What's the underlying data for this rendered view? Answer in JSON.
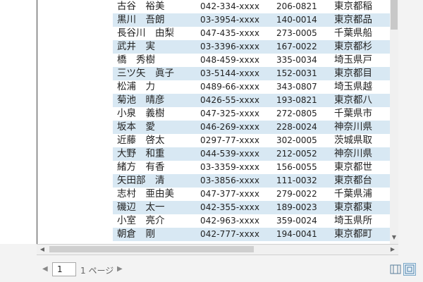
{
  "table": {
    "rows": [
      {
        "name": "古谷　裕美",
        "phone": "042-334-xxxx",
        "zip": "206-0821",
        "addr": "東京都稲"
      },
      {
        "name": "黒川　吾朗",
        "phone": "03-3954-xxxx",
        "zip": "140-0014",
        "addr": "東京都品"
      },
      {
        "name": "長谷川　由梨",
        "phone": "047-435-xxxx",
        "zip": "273-0005",
        "addr": "千葉県船"
      },
      {
        "name": "武井　実",
        "phone": "03-3396-xxxx",
        "zip": "167-0022",
        "addr": "東京都杉"
      },
      {
        "name": "橋　秀樹",
        "phone": "048-459-xxxx",
        "zip": "335-0034",
        "addr": "埼玉県戸"
      },
      {
        "name": "三ツ矢　眞子",
        "phone": "03-5144-xxxx",
        "zip": "152-0031",
        "addr": "東京都目"
      },
      {
        "name": "松浦　力",
        "phone": "0489-66-xxxx",
        "zip": "343-0807",
        "addr": "埼玉県越"
      },
      {
        "name": "菊池　晴彦",
        "phone": "0426-55-xxxx",
        "zip": "193-0821",
        "addr": "東京都八"
      },
      {
        "name": "小泉　義樹",
        "phone": "047-325-xxxx",
        "zip": "272-0805",
        "addr": "千葉県市"
      },
      {
        "name": "坂本　愛",
        "phone": "046-269-xxxx",
        "zip": "228-0024",
        "addr": "神奈川県"
      },
      {
        "name": "近藤　啓太",
        "phone": "0297-77-xxxx",
        "zip": "302-0005",
        "addr": "茨城県取"
      },
      {
        "name": "大野　和重",
        "phone": "044-539-xxxx",
        "zip": "212-0052",
        "addr": "神奈川県"
      },
      {
        "name": "緒方　有香",
        "phone": "03-3359-xxxx",
        "zip": "156-0055",
        "addr": "東京都世"
      },
      {
        "name": "矢田部　清",
        "phone": "03-3856-xxxx",
        "zip": "111-0032",
        "addr": "東京都台"
      },
      {
        "name": "志村　亜由美",
        "phone": "047-377-xxxx",
        "zip": "279-0022",
        "addr": "千葉県浦"
      },
      {
        "name": "磯辺　太一",
        "phone": "042-355-xxxx",
        "zip": "189-0023",
        "addr": "東京都東"
      },
      {
        "name": "小室　亮介",
        "phone": "042-963-xxxx",
        "zip": "359-0024",
        "addr": "埼玉県所"
      },
      {
        "name": "朝倉　剛",
        "phone": "042-777-xxxx",
        "zip": "194-0041",
        "addr": "東京都町"
      }
    ]
  },
  "pager": {
    "current_page": "1",
    "page_label": "1 ページ"
  },
  "icons": {
    "prev": "◀",
    "next": "▶",
    "scroll_down": "▼",
    "scroll_left": "◀",
    "scroll_right": "▶"
  },
  "colors": {
    "alt_row": "#d8e8f3",
    "accent": "#7aa7c7"
  }
}
